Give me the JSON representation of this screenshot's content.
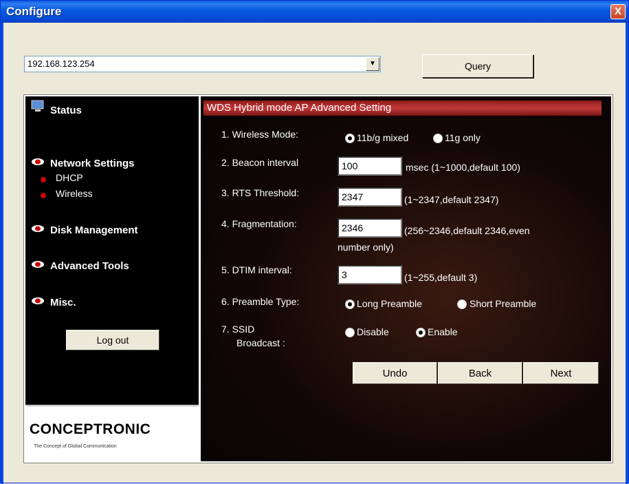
{
  "window": {
    "title": "Configure",
    "close_glyph": "X"
  },
  "address": {
    "value": "192.168.123.254",
    "dropdown_glyph": "▼",
    "query_label": "Query"
  },
  "sidebar": {
    "status": "Status",
    "network_settings": "Network Settings",
    "dhcp": "DHCP",
    "wireless": "Wireless",
    "disk_management": "Disk Management",
    "advanced_tools": "Advanced Tools",
    "misc": "Misc.",
    "logout": "Log out"
  },
  "logo": {
    "main": "CONCEPTRONIC",
    "sub": "The Concept of Global Communication"
  },
  "form": {
    "section_title": "WDS Hybrid mode AP Advanced Setting",
    "wireless_mode": {
      "label": "1. Wireless Mode:",
      "opt1": "11b/g mixed",
      "opt2": "11g only",
      "selected": "11b/g mixed"
    },
    "beacon": {
      "label": "2. Beacon interval",
      "value": "100",
      "hint": "msec (1~1000,default 100)"
    },
    "rts": {
      "label": "3. RTS Threshold:",
      "value": "2347",
      "hint": "(1~2347,default 2347)"
    },
    "frag": {
      "label": "4. Fragmentation:",
      "value": "2346",
      "hint": "(256~2346,default 2346,even",
      "hint2": "number only)"
    },
    "dtim": {
      "label": "5. DTIM interval:",
      "value": "3",
      "hint": "(1~255,default 3)"
    },
    "preamble": {
      "label": "6. Preamble Type:",
      "opt1": "Long Preamble",
      "opt2": "Short Preamble",
      "selected": "Long Preamble"
    },
    "ssid": {
      "label1": "7. SSID",
      "label2": "Broadcast :",
      "opt1": "Disable",
      "opt2": "Enable",
      "selected": "Enable"
    },
    "buttons": {
      "undo": "Undo",
      "back": "Back",
      "next": "Next"
    }
  },
  "colors": {
    "titlebar": "#0a5be0",
    "section_bar": "#b02a2a",
    "sidebar_bg": "#000000",
    "bullet": "#cc0000"
  }
}
